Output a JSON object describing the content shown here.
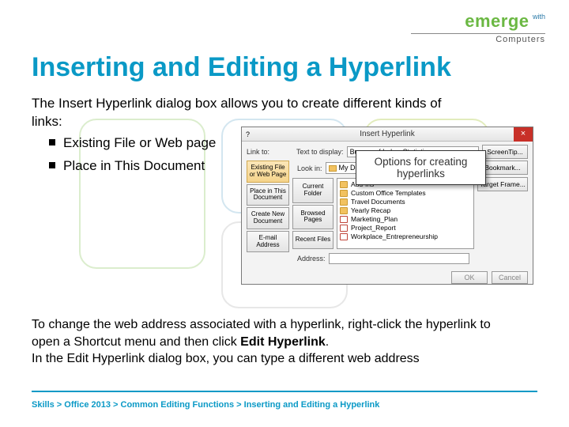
{
  "logo": {
    "main": "emerge",
    "with": "with",
    "sub": "Computers"
  },
  "title": "Inserting and Editing a Hyperlink",
  "intro": "The Insert Hyperlink dialog box allows you to create different kinds of links:",
  "bullets": [
    "Existing File or Web page",
    "Place in This Document"
  ],
  "dialog": {
    "window_title": "Insert Hyperlink",
    "link_to_label": "Link to:",
    "text_display_label": "Text to display:",
    "text_display_value": "Bureau of Labor Statistics",
    "look_in_label": "Look in:",
    "look_in_value": "My Documents",
    "screentip_btn": "ScreenTip...",
    "bookmark_btn": "Bookmark...",
    "target_btn": "Target Frame...",
    "ok": "OK",
    "cancel": "Cancel",
    "left_tabs": [
      "Existing File or Web Page",
      "Place in This Document",
      "Create New Document",
      "E-mail Address"
    ],
    "mid_tabs": [
      "Current Folder",
      "Browsed Pages",
      "Recent Files"
    ],
    "files": [
      {
        "icon": "fld",
        "name": "Add-Ins"
      },
      {
        "icon": "fld",
        "name": "Custom Office Templates"
      },
      {
        "icon": "fld",
        "name": "Travel Documents"
      },
      {
        "icon": "fld",
        "name": "Yearly Recap"
      },
      {
        "icon": "doc",
        "name": "Marketing_Plan"
      },
      {
        "icon": "doc",
        "name": "Project_Report"
      },
      {
        "icon": "doc",
        "name": "Workplace_Entrepreneurship"
      }
    ],
    "address_label": "Address:"
  },
  "callout": "Options for creating hyperlinks",
  "para2_a": "To change the web address associated with a hyperlink, right-click the hyperlink to open a Shortcut menu and then click ",
  "para2_b": "Edit Hyperlink",
  "para2_c": ".",
  "para2_d": "In the Edit Hyperlink dialog box, you can type a different web address",
  "breadcrumb": "Skills > Office 2013 > Common Editing Functions > Inserting and Editing a Hyperlink"
}
